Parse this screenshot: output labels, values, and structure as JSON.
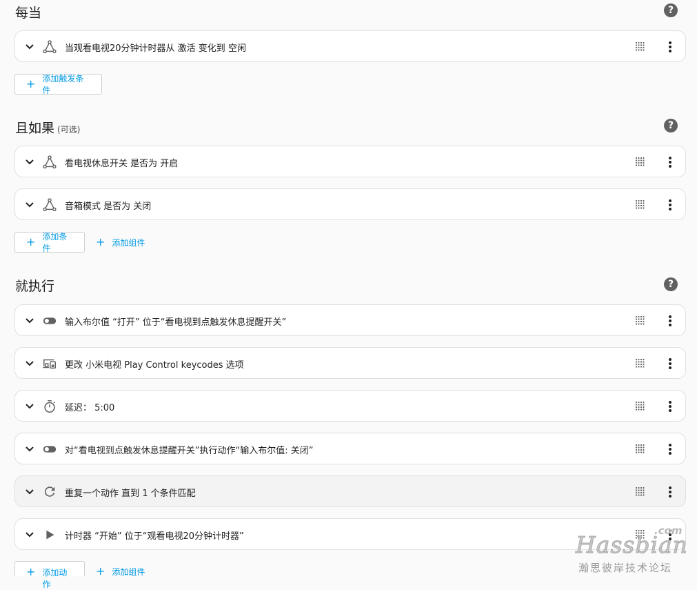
{
  "triggers": {
    "title": "每当",
    "items": [
      {
        "label": "当观看电视20分钟计时器从 激活 变化到 空闲",
        "icon": "entity-state-icon"
      }
    ],
    "add_label": "添加触发条件"
  },
  "conditions": {
    "title": "且如果",
    "optional": "(可选)",
    "items": [
      {
        "label": "看电视休息开关 是否为 开启",
        "icon": "entity-state-icon"
      },
      {
        "label": "音箱模式 是否为 关闭",
        "icon": "entity-state-icon"
      }
    ],
    "add_condition_label": "添加条件",
    "add_block_label": "添加组件"
  },
  "actions": {
    "title": "就执行",
    "items": [
      {
        "label": "输入布尔值 “打开” 位于“看电视到点触发休息提醒开关”",
        "icon": "toggle-switch-icon"
      },
      {
        "label": "更改 小米电视 Play Control keycodes 选项",
        "icon": "devices-icon"
      },
      {
        "label": "延迟： 5:00",
        "icon": "timer-icon"
      },
      {
        "label": "对“看电视到点触发休息提醒开关”执行动作“输入布尔值: 关闭”",
        "icon": "toggle-switch-icon"
      },
      {
        "label": "重复一个动作 直到 1 个条件匹配",
        "icon": "refresh-icon"
      },
      {
        "label": "计时器 “开始” 位于“观看电视20分钟计时器”",
        "icon": "play-icon"
      }
    ],
    "add_action_label": "添加动作",
    "add_block_label": "添加组件"
  },
  "help_glyph": "?",
  "plus_glyph": "+",
  "watermark": {
    "com": ".com",
    "name": "Hassbian",
    "sub": "瀚思彼岸技术论坛"
  },
  "colors": {
    "accent": "#039be5",
    "icon": "#616161",
    "highlight_row": "#f3f3f3"
  }
}
